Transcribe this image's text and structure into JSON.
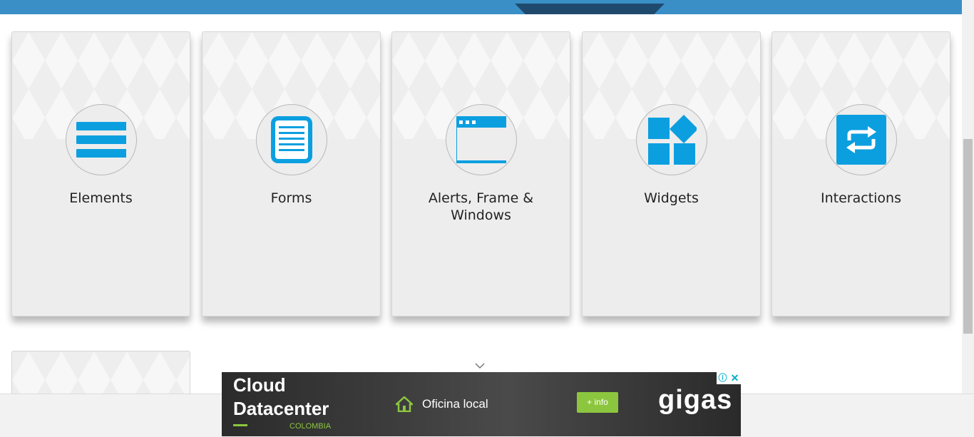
{
  "cards": [
    {
      "title": "Elements",
      "icon": "menu-lines-icon"
    },
    {
      "title": "Forms",
      "icon": "document-icon"
    },
    {
      "title": "Alerts, Frame & Windows",
      "icon": "browser-window-icon"
    },
    {
      "title": "Widgets",
      "icon": "widgets-grid-icon"
    },
    {
      "title": "Interactions",
      "icon": "swap-arrows-icon"
    }
  ],
  "colors": {
    "accent": "#0c9fe0",
    "header": "#3a8fc7",
    "header_tab": "#1f4a6e",
    "card_bg": "#ededed",
    "ad_green": "#8cc63f"
  },
  "ad": {
    "title_line1": "Cloud",
    "title_line2": "Datacenter",
    "country": "COLOMBIA",
    "feature": "Oficina local",
    "button": "+ info",
    "brand": "gigas",
    "info_icon": "ⓘ",
    "close_icon": "✕"
  }
}
